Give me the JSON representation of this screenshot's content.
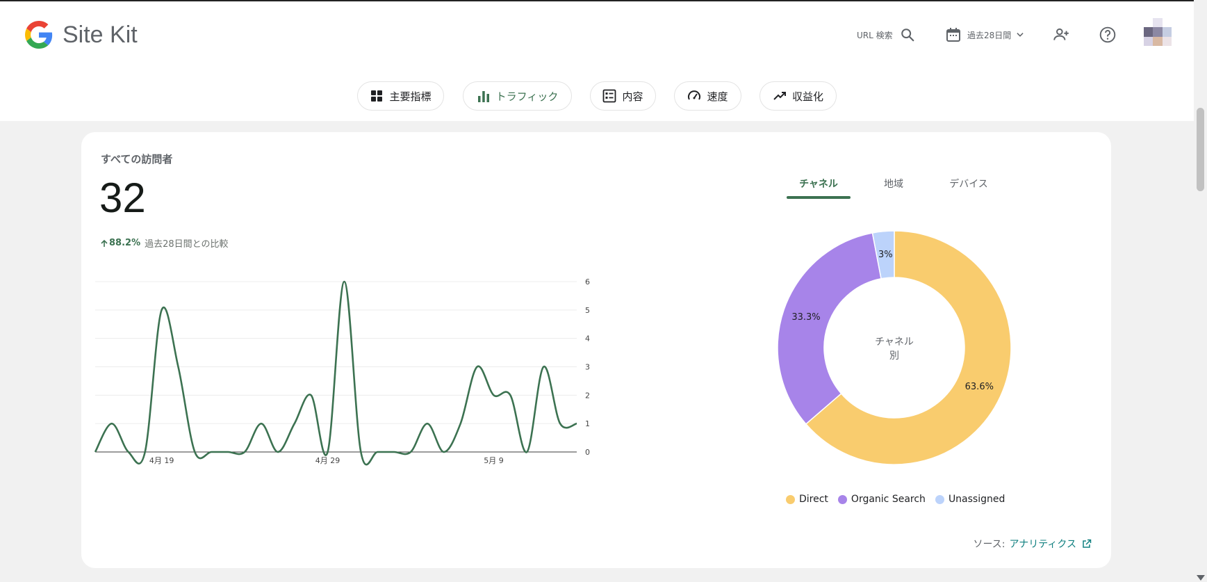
{
  "header": {
    "brand": "Site Kit",
    "url_search_label": "URL 検索",
    "date_range_label": "過去28日間",
    "icons": [
      "google-g-icon",
      "search-icon",
      "calendar-icon",
      "chevron-down-icon",
      "add-user-icon",
      "help-icon"
    ]
  },
  "nav": {
    "tabs": [
      {
        "label": "主要指標",
        "icon": "grid-icon"
      },
      {
        "label": "トラフィック",
        "icon": "bar-chart-icon",
        "active": true
      },
      {
        "label": "内容",
        "icon": "list-icon"
      },
      {
        "label": "速度",
        "icon": "speedometer-icon"
      },
      {
        "label": "収益化",
        "icon": "trending-up-icon"
      }
    ]
  },
  "card": {
    "title": "すべての訪問者",
    "value": "32",
    "change_pct": "88.2%",
    "change_label": "過去28日間との比較",
    "source_label": "ソース:",
    "source_link": "アナリティクス"
  },
  "panel": {
    "tabs": [
      "チャネル",
      "地域",
      "デバイス"
    ],
    "active_tab": 0
  },
  "colors": {
    "accent": "#3c7251",
    "line": "#3c7251",
    "direct": "#f9cc6e",
    "organic": "#a784e9",
    "unassigned": "#bcd3fb",
    "link": "#108080"
  },
  "chart_data": [
    {
      "type": "line",
      "title": "",
      "x": [
        "4月 15",
        "4月 16",
        "4月 17",
        "4月 18",
        "4月 19",
        "4月 20",
        "4月 21",
        "4月 22",
        "4月 23",
        "4月 24",
        "4月 25",
        "4月 26",
        "4月 27",
        "4月 28",
        "4月 29",
        "4月 30",
        "5月 1",
        "5月 2",
        "5月 3",
        "5月 4",
        "5月 5",
        "5月 6",
        "5月 7",
        "5月 8",
        "5月 9",
        "5月 10",
        "5月 11",
        "5月 12",
        "5月 13",
        "5月 14"
      ],
      "xticks": [
        "4月 19",
        "4月 29",
        "5月 9"
      ],
      "yticks": [
        0,
        1,
        2,
        3,
        4,
        5,
        6
      ],
      "ylim": [
        0,
        6
      ],
      "series": [
        {
          "values": [
            0,
            1,
            0,
            0,
            5,
            3,
            0,
            0,
            0,
            0,
            1,
            0,
            1,
            2,
            0,
            6,
            0,
            0,
            0,
            0,
            1,
            0,
            1,
            3,
            2,
            2,
            0,
            3,
            1,
            1
          ]
        }
      ]
    },
    {
      "type": "pie",
      "title": "",
      "center_label_line1": "チャネル",
      "center_label_line2": "別",
      "slices": [
        {
          "name": "Direct",
          "value": 63.6,
          "label": "63.6%"
        },
        {
          "name": "Organic Search",
          "value": 33.3,
          "label": "33.3%"
        },
        {
          "name": "Unassigned",
          "value": 3.0,
          "label": "3%"
        }
      ]
    }
  ]
}
